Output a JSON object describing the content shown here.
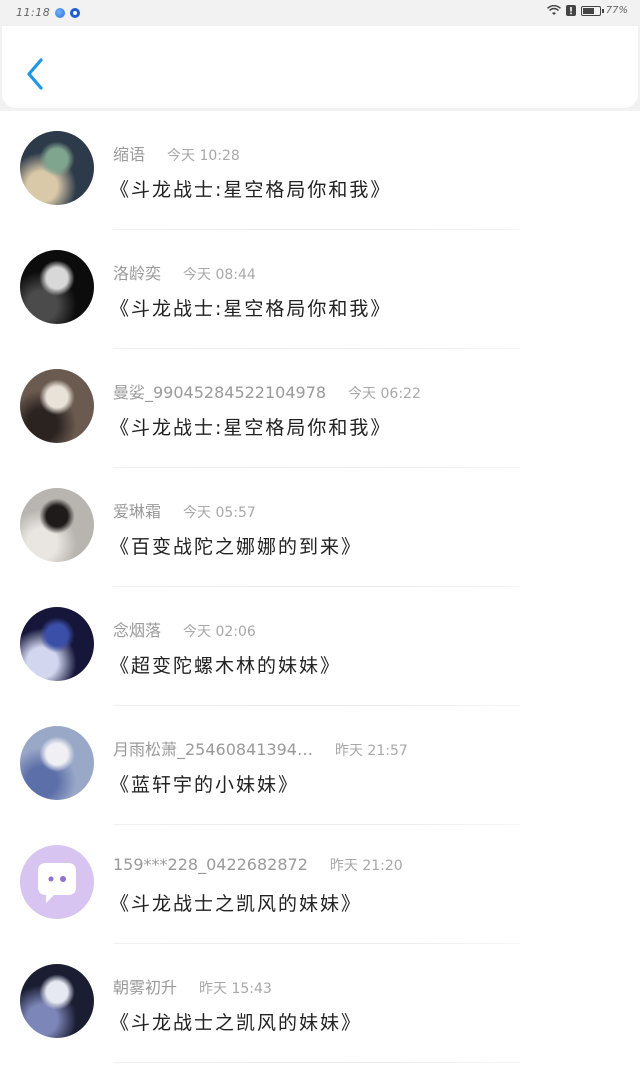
{
  "status_bar": {
    "time": "11:18",
    "battery": "77%",
    "battery_level": 0.77
  },
  "header": {
    "back_icon": "chevron-left-icon",
    "accent_color": "#1f97e8"
  },
  "items": [
    {
      "name": "缩语",
      "time": "今天 10:28",
      "title": "《斗龙战士:星空格局你和我》",
      "avatar_colors": [
        "#2d3a4a",
        "#7fa58f",
        "#d9c9a8"
      ]
    },
    {
      "name": "洛龄奕",
      "time": "今天 08:44",
      "title": "《斗龙战士:星空格局你和我》",
      "avatar_colors": [
        "#0c0c0c",
        "#d8d8d8",
        "#4b4b4b"
      ]
    },
    {
      "name": "曼娑_99045284522104978",
      "time": "今天 06:22",
      "title": "《斗龙战士:星空格局你和我》",
      "avatar_colors": [
        "#6a5a4f",
        "#e9e2d8",
        "#2a2320"
      ]
    },
    {
      "name": "爱琳霜",
      "time": "今天 05:57",
      "title": "《百变战陀之娜娜的到来》",
      "avatar_colors": [
        "#b8b4b0",
        "#1e1b1a",
        "#e9e6e1"
      ]
    },
    {
      "name": "念烟落",
      "time": "今天 02:06",
      "title": "《超变陀螺木林的妹妹》",
      "avatar_colors": [
        "#15163a",
        "#3b4fa8",
        "#d2d6ef"
      ]
    },
    {
      "name": "月雨松萧_25460841394…",
      "time": "昨天 21:57",
      "title": "《蓝轩宇的小妹妹》",
      "avatar_colors": [
        "#9aa8c8",
        "#f0f0f4",
        "#5d6fa8"
      ]
    },
    {
      "name": "159***228_0422682872",
      "time": "昨天 21:20",
      "title": "《斗龙战士之凯风的妹妹》",
      "avatar_colors": [
        "#d7c4f0",
        "#ffffff",
        "#8f6fd0"
      ]
    },
    {
      "name": "朝雾初升",
      "time": "昨天 15:43",
      "title": "《斗龙战士之凯风的妹妹》",
      "avatar_colors": [
        "#1b1e33",
        "#e6e8f2",
        "#7c86b8"
      ]
    }
  ]
}
